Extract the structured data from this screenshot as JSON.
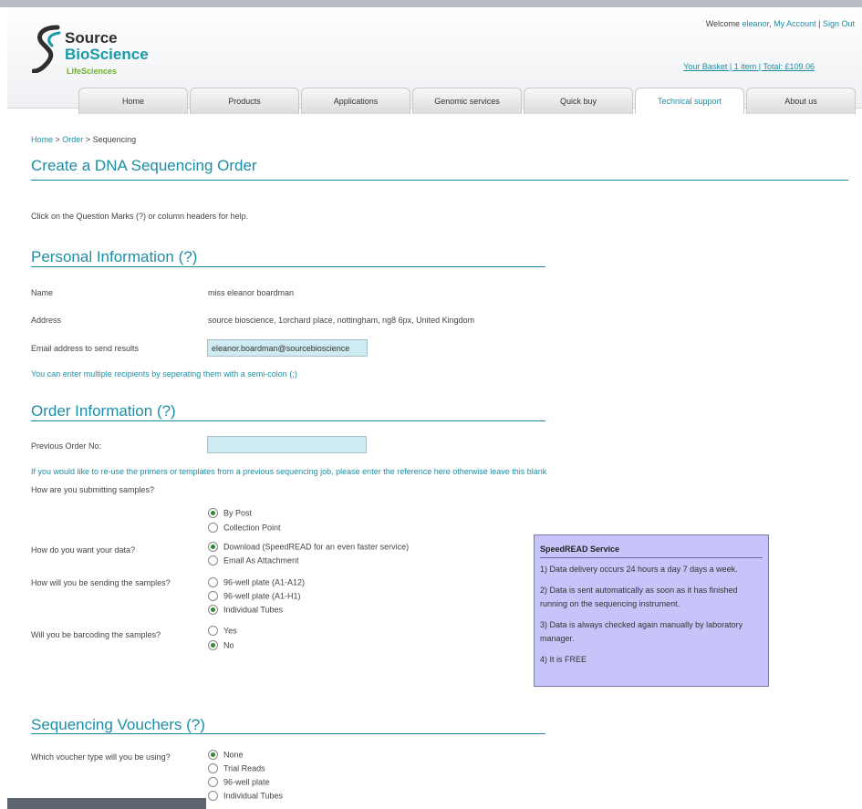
{
  "header": {
    "logo": {
      "line1": "Source",
      "line2": "BioScience",
      "line3": "LifeSciences"
    },
    "welcome_prefix": "Welcome ",
    "username": "eleanor",
    "my_account": "My Account",
    "sep1": " | ",
    "sign_out": "Sign Out",
    "basket_text": "Your Basket | 1 item | Total: £109.06"
  },
  "nav": {
    "tabs": [
      {
        "label": "Home"
      },
      {
        "label": "Products"
      },
      {
        "label": "Applications"
      },
      {
        "label": "Genomic services"
      },
      {
        "label": "Quick buy"
      },
      {
        "label": "Technical support"
      },
      {
        "label": "About us"
      }
    ],
    "active": "Technical support"
  },
  "breadcrumb": {
    "home": "Home",
    "sep": " > ",
    "order": "Order",
    "current": "Sequencing"
  },
  "page_title": "Create a DNA Sequencing Order",
  "help_text": "Click on the Question Marks (?) or column headers for help.",
  "personal": {
    "heading": "Personal Information (?)",
    "name_label": "Name",
    "name_value": "miss eleanor boardman",
    "address_label": "Address",
    "address_value": "source bioscience, 1orchard place, nottingham, ng8 6px, United Kingdom",
    "email_label": "Email address to send results",
    "email_value": "eleanor.boardman@sourcebioscience",
    "email_note": "You can enter multiple recipients by seperating them with a semi-colon (;)"
  },
  "order": {
    "heading": "Order Information (?)",
    "prev_label": "Previous Order No:",
    "prev_value": "",
    "prev_note": "If you would like to re-use the primers or templates from a previous sequencing job, please enter the reference here otherwise leave this blank",
    "submit_label": "How are you submitting samples?",
    "submit_options": [
      "By Post",
      "Collection Point"
    ],
    "submit_selected": "By Post",
    "data_label": "How do you want your data?",
    "data_options": [
      "Download (SpeedREAD for an even faster service)",
      "Email As Attachment"
    ],
    "data_selected": "Download (SpeedREAD for an even faster service)",
    "sending_label": "How will you be sending the samples?",
    "sending_options": [
      "96-well plate (A1-A12)",
      "96-well plate (A1-H1)",
      "Individual Tubes"
    ],
    "sending_selected": "Individual Tubes",
    "barcode_label": "Will you be barcoding the samples?",
    "barcode_options": [
      "Yes",
      "No"
    ],
    "barcode_selected": "No"
  },
  "speedread": {
    "title": "SpeedREAD Service",
    "items": [
      "1) Data delivery occurs 24 hours a day 7 days a week.",
      "2) Data is sent automatically as soon as it has finished running on the sequencing instrument.",
      "3) Data is always checked again manually by laboratory manager.",
      "4) It is FREE"
    ]
  },
  "vouchers": {
    "heading": "Sequencing Vouchers (?)",
    "label": "Which voucher type will you be using?",
    "options": [
      "None",
      "Trial Reads",
      "96-well plate",
      "Individual Tubes"
    ],
    "selected": "None"
  },
  "colors": {
    "accent": "#1c8ea5",
    "input_bg": "#cdebf0",
    "info_bg": "#c6c4f8",
    "radio_on": "#2d8a2d"
  }
}
